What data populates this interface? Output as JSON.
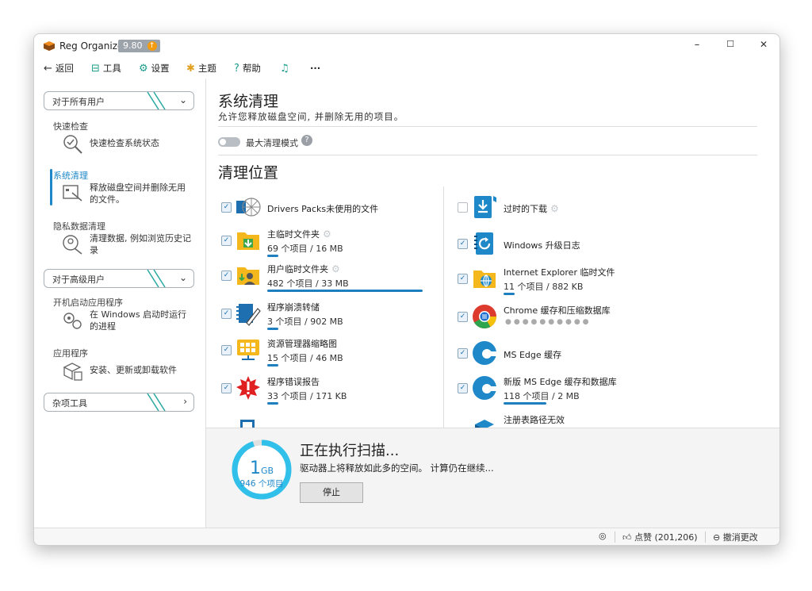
{
  "app": {
    "title": "Reg Organizer",
    "version": "9.80",
    "update_icon": "up-arrow-icon",
    "window_controls": {
      "minimize": "–",
      "maximize": "☐",
      "close": "✕"
    }
  },
  "menu": {
    "back": "返回",
    "tools": "工具",
    "settings": "设置",
    "theme": "主题",
    "help": "帮助",
    "more": "···"
  },
  "sidebar": {
    "group_all_users": "对于所有用户",
    "group_advanced": "对于高级用户",
    "group_misc": "杂项工具",
    "items": [
      {
        "title": "快速检查",
        "desc": "快速检查系统状态",
        "icon": "magnifier-check-icon"
      },
      {
        "title": "系统清理",
        "desc": "释放磁盘空间并删除无用的文件。",
        "icon": "cleanup-brush-icon",
        "active": true
      },
      {
        "title": "隐私数据清理",
        "desc": "清理数据, 例如浏览历史记录",
        "icon": "privacy-icon"
      },
      {
        "title": "开机启动应用程序",
        "desc": "在 Windows 启动时运行的进程",
        "icon": "startup-gears-icon"
      },
      {
        "title": "应用程序",
        "desc": "安装、更新或卸载软件",
        "icon": "package-icon"
      }
    ]
  },
  "main": {
    "title": "系统清理",
    "subtitle": "允许您释放磁盘空间, 并删除无用的项目。",
    "max_mode_label": "最大清理模式",
    "help_glyph": "?",
    "section_title": "清理位置",
    "left_items": [
      {
        "name": "Drivers Packs未使用的文件",
        "count": "",
        "checked": true,
        "progress": 0
      },
      {
        "name": "主临时文件夹",
        "count": "69 个项目 / 16 MB",
        "checked": true,
        "progress": 0.07,
        "gear": true
      },
      {
        "name": "用户临时文件夹",
        "count": "482 个项目 / 33 MB",
        "checked": true,
        "progress": 0.98,
        "gear": true
      },
      {
        "name": "程序崩溃转储",
        "count": "3 个项目 / 902 MB",
        "checked": true,
        "progress": 0.07
      },
      {
        "name": "资源管理器缩略图",
        "count": "15 个项目 / 46 MB",
        "checked": true,
        "progress": 0.07
      },
      {
        "name": "程序错误报告",
        "count": "33 个项目 / 171 KB",
        "checked": true,
        "progress": 0.07
      }
    ],
    "right_items": [
      {
        "name": "过时的下载",
        "count": "",
        "checked": false,
        "progress": 0,
        "gear": true
      },
      {
        "name": "Windows 升级日志",
        "count": "",
        "checked": true,
        "progress": 0
      },
      {
        "name": "Internet Explorer 临时文件",
        "count": "11 个项目 / 882 KB",
        "checked": true,
        "progress": 0.07
      },
      {
        "name": "Chrome 缓存和压缩数据库",
        "count": "",
        "checked": true,
        "progress": 0,
        "loading": true
      },
      {
        "name": "MS Edge 缓存",
        "count": "",
        "checked": true,
        "progress": 0
      },
      {
        "name": "新版 MS Edge 缓存和数据库",
        "count": "118 个项目 / 2 MB",
        "checked": true,
        "progress": 0.27
      },
      {
        "name": "注册表路径无效",
        "count": "",
        "checked": true,
        "progress": 0
      }
    ],
    "checkmark": "✓",
    "gear_glyph": "⚙",
    "loading_dots": "●●●●●●●●●●"
  },
  "scan": {
    "amount": "1",
    "unit": "GB",
    "items": "946 个项目",
    "title": "正在执行扫描...",
    "desc": "驱动器上将释放如此多的空间。 计算仍在继续...",
    "stop": "停止",
    "ring_progress": 0.95
  },
  "status": {
    "headset_icon": "headset-icon",
    "like": "点赞 (201,206)",
    "undo": "撤消更改"
  },
  "colors": {
    "accent": "#1e88c8",
    "teal_icon": "#1a9c8a",
    "ring": "#30c0ea"
  }
}
